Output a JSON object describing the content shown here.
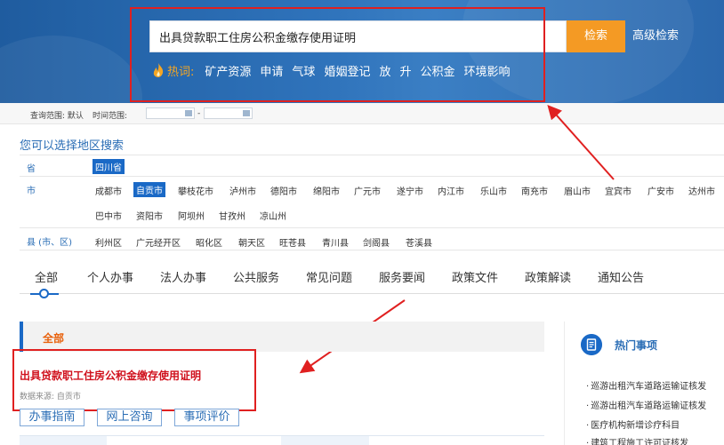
{
  "search": {
    "value": "出具贷款职工住房公积金缴存使用证明",
    "button_label": "检索",
    "advanced_label": "高级检索",
    "hot_label": "热词:",
    "hot_words": [
      "矿产资源",
      "申请",
      "气球",
      "婚姻登记",
      "放",
      "升",
      "公积金",
      "环境影响"
    ]
  },
  "query": {
    "scope_label": "查询范围: 默认",
    "time_label": "时间范围:",
    "separator": "-"
  },
  "region": {
    "title": "您可以选择地区搜索",
    "province_label": "省",
    "provinces": [
      "四川省"
    ],
    "city_label": "市",
    "cities_row1": [
      "成都市",
      "自贡市",
      "攀枝花市",
      "泸州市",
      "德阳市",
      "绵阳市",
      "广元市",
      "遂宁市",
      "内江市",
      "乐山市",
      "南充市",
      "眉山市",
      "宜宾市",
      "广安市",
      "达州市"
    ],
    "cities_row2": [
      "巴中市",
      "资阳市",
      "阿坝州",
      "甘孜州",
      "凉山州"
    ],
    "county_label": "县 (市、区)",
    "counties": [
      "利州区",
      "广元经开区",
      "昭化区",
      "朝天区",
      "旺苍县",
      "青川县",
      "剑阁县",
      "苍溪县"
    ]
  },
  "tabs": [
    "全部",
    "个人办事",
    "法人办事",
    "公共服务",
    "常见问题",
    "服务要闻",
    "政策文件",
    "政策解读",
    "通知公告"
  ],
  "results": {
    "section_title": "全部",
    "item_title": "出具贷款职工住房公积金缴存使用证明",
    "item_source": "数据来源: 自贡市",
    "buttons": [
      "办事指南",
      "网上咨询",
      "事项评价"
    ]
  },
  "hot_items": {
    "title": "热门事项",
    "items": [
      "巡游出租汽车道路运输证核发",
      "巡游出租汽车道路运输证核发",
      "医疗机构新增诊疗科目",
      "建筑工程施工许可证核发"
    ]
  },
  "colors": {
    "header_blue": "#2f73bb",
    "search_orange": "#f49a24",
    "link_blue": "#2a6db5",
    "selected_blue": "#1a69c6",
    "highlight_red": "#d0111d",
    "annotation_red": "#e02020"
  }
}
